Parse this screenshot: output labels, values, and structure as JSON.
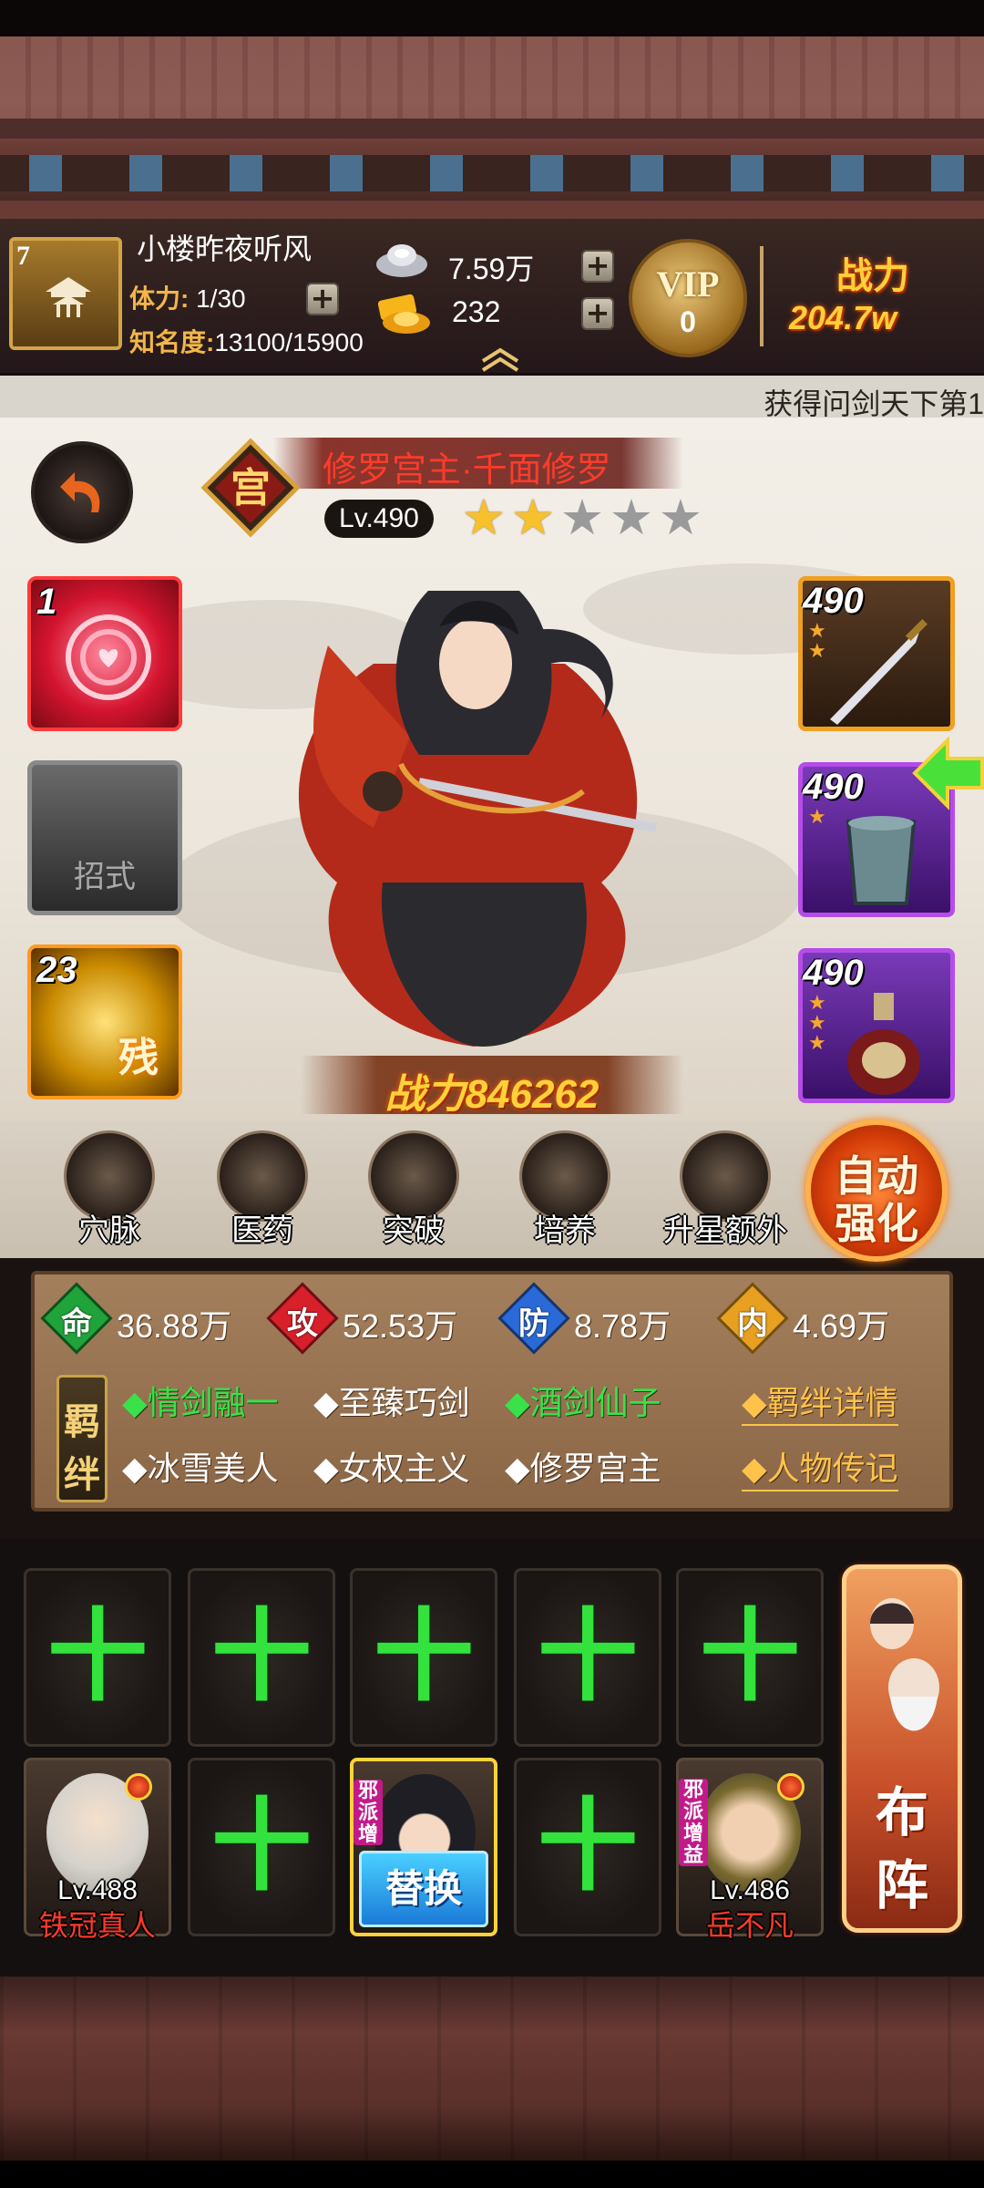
{
  "header": {
    "player_name": "小楼昨夜听风",
    "level": "7",
    "stamina_label": "体力:",
    "stamina_value": "1/30",
    "fame_label": "知名度:",
    "fame_value": "13100/15900",
    "silver": "7.59万",
    "gold": "232",
    "vip_label": "VIP",
    "vip_level": "0",
    "power_label": "战力",
    "power_value": "204.7w"
  },
  "ticker": "获得问剑天下第1",
  "hero": {
    "name": "修罗宫主·千面修罗",
    "badge": "宫",
    "level": "Lv.490",
    "stars_filled": 2,
    "stars_total": 5,
    "power": "战力846262"
  },
  "skills": [
    {
      "level": "1"
    },
    {
      "label": "招式"
    },
    {
      "level": "23",
      "tag": "残"
    }
  ],
  "equipment": [
    {
      "level": "490",
      "stars": 2
    },
    {
      "level": "490",
      "stars": 1
    },
    {
      "level": "490",
      "stars": 3
    }
  ],
  "functions": [
    "穴脉",
    "医药",
    "突破",
    "培养",
    "升星额外"
  ],
  "auto_button": [
    "自动",
    "强化"
  ],
  "stats": [
    {
      "icon": "命",
      "value": "36.88万",
      "color": "#1fa33a"
    },
    {
      "icon": "攻",
      "value": "52.53万",
      "color": "#d8202a"
    },
    {
      "icon": "防",
      "value": "8.78万",
      "color": "#2a6ad8"
    },
    {
      "icon": "内",
      "value": "4.69万",
      "color": "#e8a020"
    }
  ],
  "bond_label": [
    "羁",
    "绊"
  ],
  "bonds_row1": [
    "◆情剑融一",
    "◆至臻巧剑",
    "◆酒剑仙子"
  ],
  "bonds_row2": [
    "◆冰雪美人",
    "◆女权主义",
    "◆修罗宫主"
  ],
  "links": [
    "◆羁绊详情",
    "◆人物传记"
  ],
  "team": {
    "plus": "十",
    "heroes": [
      {
        "level": "Lv.488",
        "name": "铁冠真人"
      },
      {
        "swap": "替换",
        "tag": "邪派增"
      },
      {
        "level": "Lv.486",
        "name": "岳不凡",
        "tag": "邪派增益"
      }
    ]
  },
  "formation": [
    "布",
    "阵"
  ]
}
